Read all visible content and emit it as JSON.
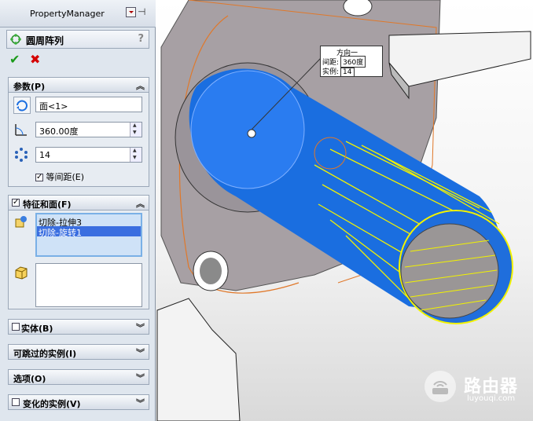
{
  "panel": {
    "title": "PropertyManager",
    "feature_title": "圆周阵列",
    "help": "?"
  },
  "params": {
    "header": "参数(P)",
    "face_value": "面<1>",
    "angle_value": "360.00度",
    "count_value": "14",
    "equal_spacing_label": "等间距(E)",
    "equal_spacing_checked": true
  },
  "features_faces": {
    "header": "特征和面(F)",
    "checked": true,
    "features": [
      "切除-拉伸3",
      "切除-旋转1"
    ],
    "selected_index": 1
  },
  "collapsed_groups": {
    "bodies": "实体(B)",
    "skip": "可跳过的实例(I)",
    "options": "选项(O)",
    "vary": "变化的实例(V)"
  },
  "callout": {
    "title": "方向一",
    "spacing_label": "间距:",
    "spacing_value": "360度",
    "instances_label": "实例:",
    "instances_value": "14"
  },
  "watermark": {
    "text": "路由器",
    "url": "luyouqi.com"
  },
  "colors": {
    "accent_blue": "#1a6ee0",
    "selection_yellow": "#f2f200",
    "highlight_orange": "#e0782a"
  }
}
